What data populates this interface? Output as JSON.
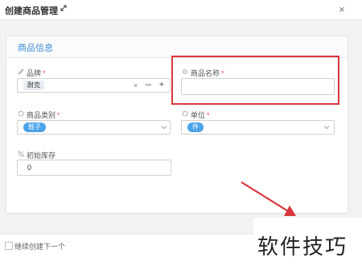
{
  "dialog": {
    "title": "创建商品管理",
    "close_symbol": "×"
  },
  "panel": {
    "title": "商品信息"
  },
  "fields": {
    "brand": {
      "label": "品牌",
      "required_mark": "*",
      "value_tag": "耐克",
      "clear_symbol": "×",
      "link_symbol": "⚯",
      "add_symbol": "+"
    },
    "product_name": {
      "label": "商品名称",
      "required_mark": "*",
      "value": ""
    },
    "category": {
      "label": "商品类别",
      "required_mark": "*",
      "value_tag": "鞋子"
    },
    "unit": {
      "label": "单位",
      "required_mark": "*",
      "value_tag": "件"
    },
    "initial_stock": {
      "label": "初始库存",
      "value": "0"
    }
  },
  "footer": {
    "continue_label": "继续创建下一个"
  },
  "watermark": {
    "text": "软件技巧"
  },
  "colors": {
    "accent": "#3c8dd6",
    "highlight": "#d9363e",
    "tag_blue": "#4aa3e8"
  },
  "icons": {
    "expand": "expand-icon",
    "close": "close-icon",
    "brand": "pencil-icon",
    "product_name": "gear-icon",
    "category": "circle-icon",
    "unit": "circle-icon",
    "initial_stock": "percent-icon"
  }
}
